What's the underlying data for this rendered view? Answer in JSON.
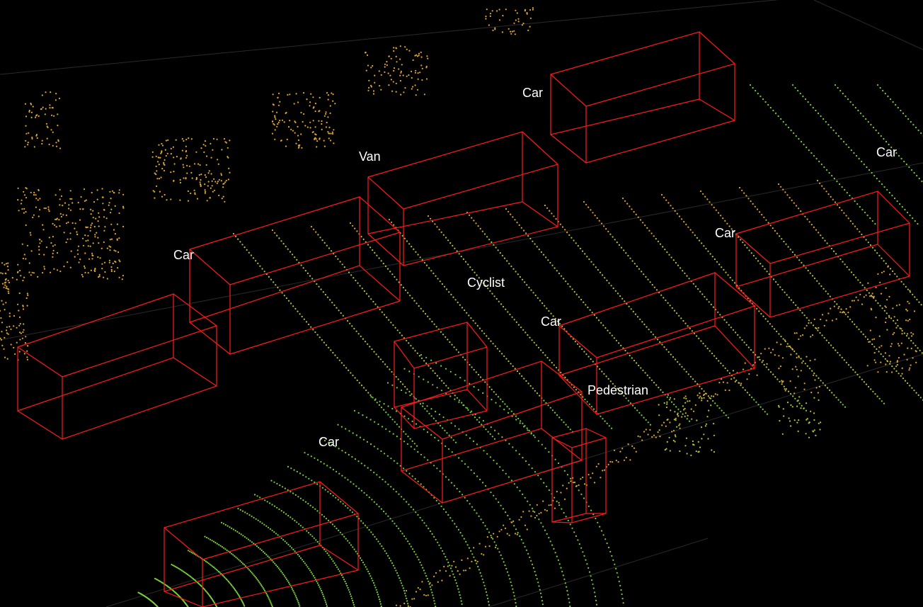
{
  "colors": {
    "background": "#000000",
    "box_edge": "#ff1a1a",
    "label_text": "#ffffff",
    "points_near": "#7ad13c",
    "points_mid": "#b5c83a",
    "points_far": "#e0a830",
    "grid": "#2a2a2a"
  },
  "objects": [
    {
      "label": "Car"
    },
    {
      "label": "Car"
    },
    {
      "label": "Van"
    },
    {
      "label": "Car"
    },
    {
      "label": "Car"
    },
    {
      "label": "Cyclist"
    },
    {
      "label": "Car"
    },
    {
      "label": "Pedestrian"
    },
    {
      "label": "Car"
    }
  ]
}
